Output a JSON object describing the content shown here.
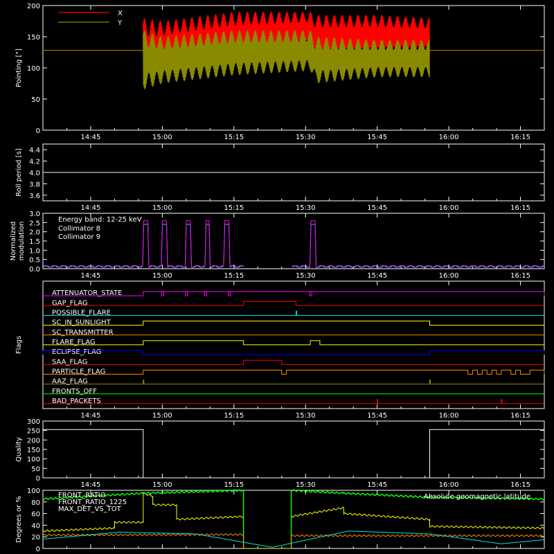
{
  "colors": {
    "background": "#000000",
    "axes": "#ffffff",
    "red": "#ff0000",
    "olive": "#8a8a00",
    "cyan": "#00e5e5",
    "magenta": "#ff00ff",
    "white": "#ffffff"
  },
  "time_axis": {
    "range": [
      "14:35",
      "16:20"
    ],
    "ticks": [
      "14:45",
      "15:00",
      "15:15",
      "15:30",
      "15:45",
      "16:00",
      "16:15"
    ]
  },
  "chart_data": [
    {
      "id": "pointing",
      "type": "line",
      "ylabel": "Pointing [\"]",
      "ylim": [
        0,
        200
      ],
      "yticks": [
        0,
        50,
        100,
        150,
        200
      ],
      "legend": [
        "X",
        "Y"
      ],
      "legend_placement": "top-left",
      "series": [
        {
          "name": "X",
          "color": "#ff0000",
          "segments": [
            {
              "x": [
                "14:35",
                "14:56"
              ],
              "y": [
                128,
                128
              ]
            },
            {
              "x": [
                "14:56",
                "15:32"
              ],
              "y": [
                130,
                150
              ]
            },
            {
              "x": [
                "15:32",
                "15:56"
              ],
              "y": [
                150,
                162
              ]
            },
            {
              "x": [
                "15:56",
                "16:20"
              ],
              "y": [
                128,
                128
              ]
            }
          ],
          "envelope": {
            "x": [
              "14:56",
              "15:00",
              "15:15",
              "15:31",
              "15:32",
              "15:45",
              "15:56"
            ],
            "upper": [
              180,
              175,
              190,
              190,
              185,
              185,
              180
            ],
            "lower": [
              70,
              90,
              110,
              130,
              110,
              115,
              120
            ]
          }
        },
        {
          "name": "Y",
          "color": "#8a8a00",
          "segments": [
            {
              "x": [
                "14:35",
                "14:56"
              ],
              "y": [
                128,
                128
              ]
            },
            {
              "x": [
                "15:56",
                "16:20"
              ],
              "y": [
                128,
                128
              ]
            }
          ],
          "envelope": {
            "x": [
              "14:56",
              "15:00",
              "15:15",
              "15:31",
              "15:32",
              "15:45",
              "15:56"
            ],
            "upper": [
              160,
              150,
              160,
              160,
              150,
              145,
              145
            ],
            "lower": [
              65,
              75,
              88,
              95,
              75,
              85,
              85
            ]
          }
        }
      ]
    },
    {
      "id": "roll",
      "type": "line",
      "ylabel": "Roll period [s]",
      "ylim": [
        3.5,
        4.5
      ],
      "yticks": [
        3.6,
        3.8,
        4.0,
        4.2,
        4.4
      ],
      "series": [
        {
          "color": "#ffffff",
          "x": [
            "14:35",
            "16:20"
          ],
          "y": [
            4.0,
            4.0
          ]
        }
      ]
    },
    {
      "id": "modulation",
      "type": "line",
      "ylabel": "Normalized modulation",
      "ylim": [
        0,
        3.0
      ],
      "yticks": [
        0.0,
        0.5,
        1.0,
        1.5,
        2.0,
        2.5,
        3.0
      ],
      "legend_title": "Energy band: 12-25 keV",
      "legend": [
        "Collimator 8",
        "Collimator 9"
      ],
      "legend_placement": "top-left",
      "series": [
        {
          "name": "Collimator 8",
          "color": "#00e5e5",
          "baseline": 0.12,
          "gaps": [
            [
              "15:17",
              "15:27"
            ]
          ],
          "spikes": [
            [
              "14:56",
              "14:57"
            ],
            [
              "15:00",
              "15:01"
            ],
            [
              "15:05",
              "15:06"
            ],
            [
              "15:09",
              "15:10"
            ],
            [
              "15:13",
              "15:14"
            ],
            [
              "15:31",
              "15:32"
            ]
          ],
          "spike_level": 2.4
        },
        {
          "name": "Collimator 9",
          "color": "#ff00ff",
          "baseline": 0.12,
          "gaps": [
            [
              "15:17",
              "15:27"
            ]
          ],
          "spikes": [
            [
              "14:56",
              "14:57"
            ],
            [
              "15:00",
              "15:01"
            ],
            [
              "15:05",
              "15:06"
            ],
            [
              "15:09",
              "15:10"
            ],
            [
              "15:13",
              "15:14"
            ],
            [
              "15:31",
              "15:32"
            ]
          ],
          "spike_level": 2.6
        }
      ]
    },
    {
      "id": "flags",
      "type": "step",
      "ylabel": "Flags",
      "flags": [
        {
          "name": "ATTENUATOR_STATE",
          "color": "#ff00ff",
          "on": [
            [
              "14:56",
              "16:20"
            ]
          ],
          "dips": [
            "15:00",
            "15:05",
            "15:09",
            "15:14",
            "15:31"
          ]
        },
        {
          "name": "GAP_FLAG",
          "color": "#ff0000",
          "on": [
            [
              "15:17",
              "15:28"
            ]
          ]
        },
        {
          "name": "POSSIBLE_FLARE",
          "color": "#00e5e5",
          "on": [
            [
              "15:28",
              "15:28"
            ]
          ]
        },
        {
          "name": "SC_IN_SUNLIGHT",
          "color": "#ffff00",
          "on": [
            [
              "14:56",
              "15:56"
            ]
          ]
        },
        {
          "name": "SC_TRANSMITTER",
          "color": "#ff8c00",
          "on": []
        },
        {
          "name": "FLARE_FLAG",
          "color": "#ffff00",
          "on": [
            [
              "14:56",
              "15:17"
            ],
            [
              "15:31",
              "15:33"
            ]
          ]
        },
        {
          "name": "ECLIPSE_FLAG",
          "color": "#0000ff",
          "on": [
            [
              "14:35",
              "14:56"
            ],
            [
              "15:56",
              "16:20"
            ]
          ]
        },
        {
          "name": "SAA_FLAG",
          "color": "#ff0000",
          "on": [
            [
              "15:17",
              "15:25"
            ]
          ]
        },
        {
          "name": "PARTICLE_FLAG",
          "color": "#ff8c00",
          "on": [
            [
              "14:56",
              "15:25"
            ],
            [
              "15:26",
              "16:04"
            ],
            [
              "16:05",
              "16:06"
            ],
            [
              "16:07",
              "16:08"
            ],
            [
              "16:09",
              "16:10"
            ],
            [
              "16:11",
              "16:13"
            ],
            [
              "16:14",
              "16:15"
            ],
            [
              "16:17",
              "16:20"
            ]
          ]
        },
        {
          "name": "AAZ_FLAG",
          "color": "#8a8a00",
          "on": [
            [
              "14:56",
              "14:56"
            ],
            [
              "15:56",
              "15:56"
            ]
          ]
        },
        {
          "name": "FRONTS_OFF",
          "color": "#00ff00",
          "on": []
        },
        {
          "name": "BAD_PACKETS",
          "color": "#ff0000",
          "on": [
            [
              "15:45",
              "15:45"
            ],
            [
              "16:11",
              "16:11"
            ]
          ]
        }
      ]
    },
    {
      "id": "quality",
      "type": "line",
      "ylabel": "Quality",
      "ylim": [
        0,
        300
      ],
      "yticks": [
        0,
        50,
        100,
        150,
        200,
        250,
        300
      ],
      "series": [
        {
          "color": "#ffffff",
          "x": [
            "14:35",
            "14:56",
            "14:56",
            "15:56",
            "15:56",
            "16:20"
          ],
          "y": [
            255,
            255,
            0,
            0,
            255,
            255
          ]
        }
      ]
    },
    {
      "id": "ratios",
      "type": "line",
      "ylabel": "Degrees or %",
      "ylim": [
        0,
        100
      ],
      "yticks": [
        0,
        20,
        40,
        60,
        80,
        100
      ],
      "legend": [
        "FRONT_RATIO",
        "FRONT_RATIO_1225",
        "MAX_DET_VS_TOT"
      ],
      "legend_placement": "top-left",
      "right_label": "Absolute geomagnetic latitude",
      "series": [
        {
          "name": "FRONT_RATIO",
          "color": "#ffff00",
          "x": [
            "14:35",
            "14:50",
            "14:50",
            "14:56",
            "14:56",
            "14:58",
            "14:58",
            "15:03",
            "15:03",
            "15:17",
            "15:17",
            "15:27",
            "15:27",
            "15:38",
            "15:38",
            "15:56",
            "15:56",
            "16:20"
          ],
          "y": [
            30,
            35,
            45,
            45,
            95,
            90,
            75,
            75,
            50,
            55,
            0,
            0,
            55,
            70,
            60,
            50,
            38,
            35
          ]
        },
        {
          "name": "FRONT_RATIO_1225",
          "color": "#00ff00",
          "x": [
            "14:35",
            "14:56",
            "15:17",
            "15:17",
            "15:27",
            "15:27",
            "15:38",
            "15:56",
            "16:20"
          ],
          "y": [
            85,
            95,
            100,
            0,
            0,
            100,
            95,
            88,
            85
          ]
        },
        {
          "name": "MAX_DET_VS_TOT",
          "color": "#ff8c00",
          "x": [
            "14:35",
            "15:17",
            "15:17",
            "15:27",
            "15:27",
            "16:20"
          ],
          "y": [
            23,
            24,
            0,
            0,
            22,
            22
          ]
        },
        {
          "name": "Absolute geomagnetic latitude",
          "color": "#00e5e5",
          "x": [
            "14:35",
            "14:51",
            "15:07",
            "15:23",
            "15:39",
            "15:56",
            "16:11",
            "16:20"
          ],
          "y": [
            16,
            28,
            25,
            2,
            30,
            25,
            8,
            15
          ]
        }
      ]
    }
  ]
}
